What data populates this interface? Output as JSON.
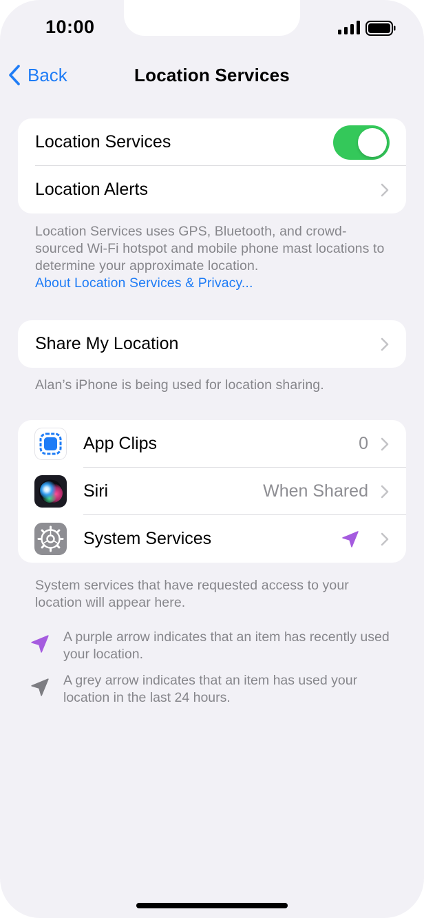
{
  "status_bar": {
    "time": "10:00"
  },
  "nav": {
    "back_label": "Back",
    "title": "Location Services"
  },
  "group_main": {
    "location_services_label": "Location Services",
    "location_services_enabled": true,
    "location_alerts_label": "Location Alerts"
  },
  "info": {
    "description": "Location Services uses GPS, Bluetooth, and crowd-sourced Wi-Fi hotspot and mobile phone mast locations to determine your approximate location.",
    "link_label": "About Location Services & Privacy..."
  },
  "share": {
    "label": "Share My Location",
    "footer": "Alan’s iPhone is being used for location sharing."
  },
  "apps": [
    {
      "label": "App Clips",
      "value": "0",
      "icon": "app-clips-icon"
    },
    {
      "label": "Siri",
      "value": "When Shared",
      "icon": "siri-icon"
    },
    {
      "label": "System Services",
      "value": "",
      "icon": "settings-gear-icon",
      "indicator": "purple-location-arrow"
    }
  ],
  "system_footer": "System services that have requested access to your location will appear here.",
  "legend": {
    "purple": "A purple arrow indicates that an item has recently used your location.",
    "grey": "A grey arrow indicates that an item has used your location in the last 24 hours."
  },
  "colors": {
    "accent": "#1e7cf6",
    "toggle_on": "#34c85a",
    "purple_arrow": "#a55bdf",
    "grey_arrow": "#8e8e93",
    "background": "#f2f1f6"
  }
}
